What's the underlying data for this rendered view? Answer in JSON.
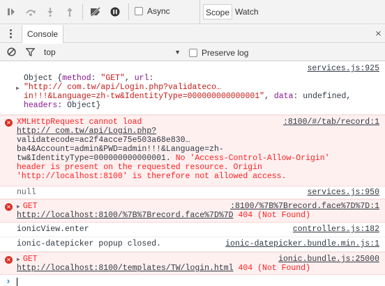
{
  "debugger_toolbar": {
    "async_label": "Async",
    "tabs": [
      "Scope",
      "Watch"
    ]
  },
  "drawer": {
    "tab_label": "Console",
    "close_glyph": "×"
  },
  "filter": {
    "context": "top",
    "preserve_log_label": "Preserve log"
  },
  "messages": {
    "m1": {
      "source": "services.js:925",
      "line1_obj": "Object {",
      "line1_k1": "method",
      "line1_v1": "\"GET\"",
      "line1_k2": "url",
      "line2_url": "\"http://            com.tw/api/Login.php?validateco…",
      "line3_url": "in!!!&Language=zh-tw&IdentityType=000000000000001\"",
      "line3_k": "data",
      "line3_v": "undefined",
      "line4_k": "headers",
      "line4_v": "Object}"
    },
    "m2": {
      "title": "XMLHttpRequest cannot load",
      "source": ":8100/#/tab/record:1",
      "line2": "http://            com.tw/api/Login.php?",
      "line3": "validatecode=ac2f4acce75e503a68e830…",
      "line4": "ba4&Account=admin&PWD=admin!!!&Language=zh-",
      "line5_plain": "tw&IdentityType=000000000000001.",
      "line5_err": " No 'Access-Control-Allow-Origin'",
      "line6": "header is present on the requested resource. Origin",
      "line7": "'http://localhost:8100' is therefore not allowed access."
    },
    "m3": {
      "text": "null",
      "source": "services.js:950"
    },
    "m4": {
      "method": "GET",
      "source": ":8100/%7B%7Brecord.face%7D%7D:1",
      "url": "http://localhost:8100/%7B%7Brecord.face%7D%7D",
      "status": "404 (Not Found)"
    },
    "m5": {
      "text": "ionicView.enter",
      "source": "controllers.js:182"
    },
    "m6": {
      "text": "ionic-datepicker popup closed.",
      "source": "ionic-datepicker.bundle.min.js:1"
    },
    "m7": {
      "method": "GET",
      "source": "ionic.bundle.js:25000",
      "url": "http://localhost:8100/templates/TW/login.html",
      "status": "404 (Not Found)"
    }
  },
  "prompt": {
    "glyph": "›"
  }
}
